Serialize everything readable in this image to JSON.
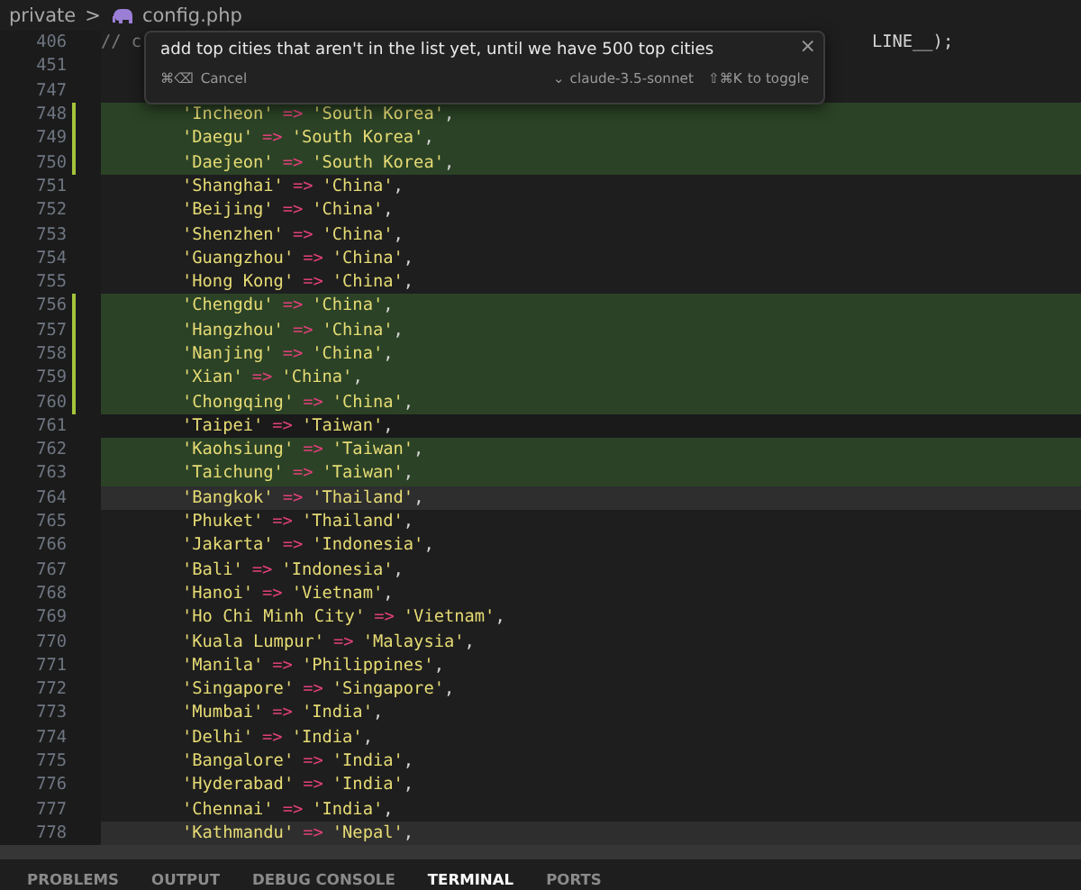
{
  "breadcrumb": {
    "folder": "private",
    "separator": ">",
    "file": "config.php"
  },
  "prompt": {
    "text": "add top cities that aren't in the list yet, until we have 500 top cities",
    "cancel_keys": "⌘⌫",
    "cancel": "Cancel",
    "model_caret": "⌄",
    "model": "claude-3.5-sonnet",
    "toggle_keys": "⇧⌘K",
    "toggle": "to toggle",
    "close": "×"
  },
  "lines": [
    {
      "num": "406",
      "kind": "plain",
      "marked": false,
      "comment": "// c",
      "tail": "LINE__);"
    },
    {
      "num": "451",
      "kind": "plain",
      "marked": false
    },
    {
      "num": "747",
      "kind": "plain",
      "marked": false
    },
    {
      "num": "748",
      "kind": "added",
      "marked": true,
      "key": "'Incheon'",
      "value": "'South Korea'"
    },
    {
      "num": "749",
      "kind": "added",
      "marked": true,
      "key": "'Daegu'",
      "value": "'South Korea'"
    },
    {
      "num": "750",
      "kind": "added",
      "marked": true,
      "key": "'Daejeon'",
      "value": "'South Korea'"
    },
    {
      "num": "751",
      "kind": "plain",
      "marked": false,
      "key": "'Shanghai'",
      "value": "'China'"
    },
    {
      "num": "752",
      "kind": "plain",
      "marked": false,
      "key": "'Beijing'",
      "value": "'China'"
    },
    {
      "num": "753",
      "kind": "plain",
      "marked": false,
      "key": "'Shenzhen'",
      "value": "'China'"
    },
    {
      "num": "754",
      "kind": "plain",
      "marked": false,
      "key": "'Guangzhou'",
      "value": "'China'"
    },
    {
      "num": "755",
      "kind": "plain",
      "marked": false,
      "key": "'Hong Kong'",
      "value": "'China'"
    },
    {
      "num": "756",
      "kind": "added",
      "marked": true,
      "key": "'Chengdu'",
      "value": "'China'"
    },
    {
      "num": "757",
      "kind": "added",
      "marked": true,
      "key": "'Hangzhou'",
      "value": "'China'"
    },
    {
      "num": "758",
      "kind": "added",
      "marked": true,
      "key": "'Nanjing'",
      "value": "'China'"
    },
    {
      "num": "759",
      "kind": "added",
      "marked": true,
      "key": "'Xian'",
      "value": "'China'"
    },
    {
      "num": "760",
      "kind": "added",
      "marked": true,
      "key": "'Chongqing'",
      "value": "'China'"
    },
    {
      "num": "761",
      "kind": "current",
      "marked": false,
      "key": "'Taipei'",
      "value": "'Taiwan'"
    },
    {
      "num": "762",
      "kind": "added",
      "marked": false,
      "key": "'Kaohsiung'",
      "value": "'Taiwan'"
    },
    {
      "num": "763",
      "kind": "added",
      "marked": false,
      "key": "'Taichung'",
      "value": "'Taiwan'"
    },
    {
      "num": "764",
      "kind": "lit",
      "marked": false,
      "key": "'Bangkok'",
      "value": "'Thailand'"
    },
    {
      "num": "765",
      "kind": "plain",
      "marked": false,
      "key": "'Phuket'",
      "value": "'Thailand'"
    },
    {
      "num": "766",
      "kind": "plain",
      "marked": false,
      "key": "'Jakarta'",
      "value": "'Indonesia'"
    },
    {
      "num": "767",
      "kind": "plain",
      "marked": false,
      "key": "'Bali'",
      "value": "'Indonesia'"
    },
    {
      "num": "768",
      "kind": "plain",
      "marked": false,
      "key": "'Hanoi'",
      "value": "'Vietnam'"
    },
    {
      "num": "769",
      "kind": "plain",
      "marked": false,
      "key": "'Ho Chi Minh City'",
      "value": "'Vietnam'"
    },
    {
      "num": "770",
      "kind": "plain",
      "marked": false,
      "key": "'Kuala Lumpur'",
      "value": "'Malaysia'"
    },
    {
      "num": "771",
      "kind": "plain",
      "marked": false,
      "key": "'Manila'",
      "value": "'Philippines'"
    },
    {
      "num": "772",
      "kind": "plain",
      "marked": false,
      "key": "'Singapore'",
      "value": "'Singapore'"
    },
    {
      "num": "773",
      "kind": "plain",
      "marked": false,
      "key": "'Mumbai'",
      "value": "'India'"
    },
    {
      "num": "774",
      "kind": "plain",
      "marked": false,
      "key": "'Delhi'",
      "value": "'India'"
    },
    {
      "num": "775",
      "kind": "plain",
      "marked": false,
      "key": "'Bangalore'",
      "value": "'India'"
    },
    {
      "num": "776",
      "kind": "plain",
      "marked": false,
      "key": "'Hyderabad'",
      "value": "'India'"
    },
    {
      "num": "777",
      "kind": "plain",
      "marked": false,
      "key": "'Chennai'",
      "value": "'India'"
    },
    {
      "num": "778",
      "kind": "lit",
      "marked": false,
      "key": "'Kathmandu'",
      "value": "'Nepal'"
    }
  ],
  "arrow": "=>",
  "comma": ",",
  "panel_tabs": [
    {
      "label": "PROBLEMS",
      "selected": false
    },
    {
      "label": "OUTPUT",
      "selected": false
    },
    {
      "label": "DEBUG CONSOLE",
      "selected": false
    },
    {
      "label": "TERMINAL",
      "selected": true
    },
    {
      "label": "PORTS",
      "selected": false
    }
  ]
}
